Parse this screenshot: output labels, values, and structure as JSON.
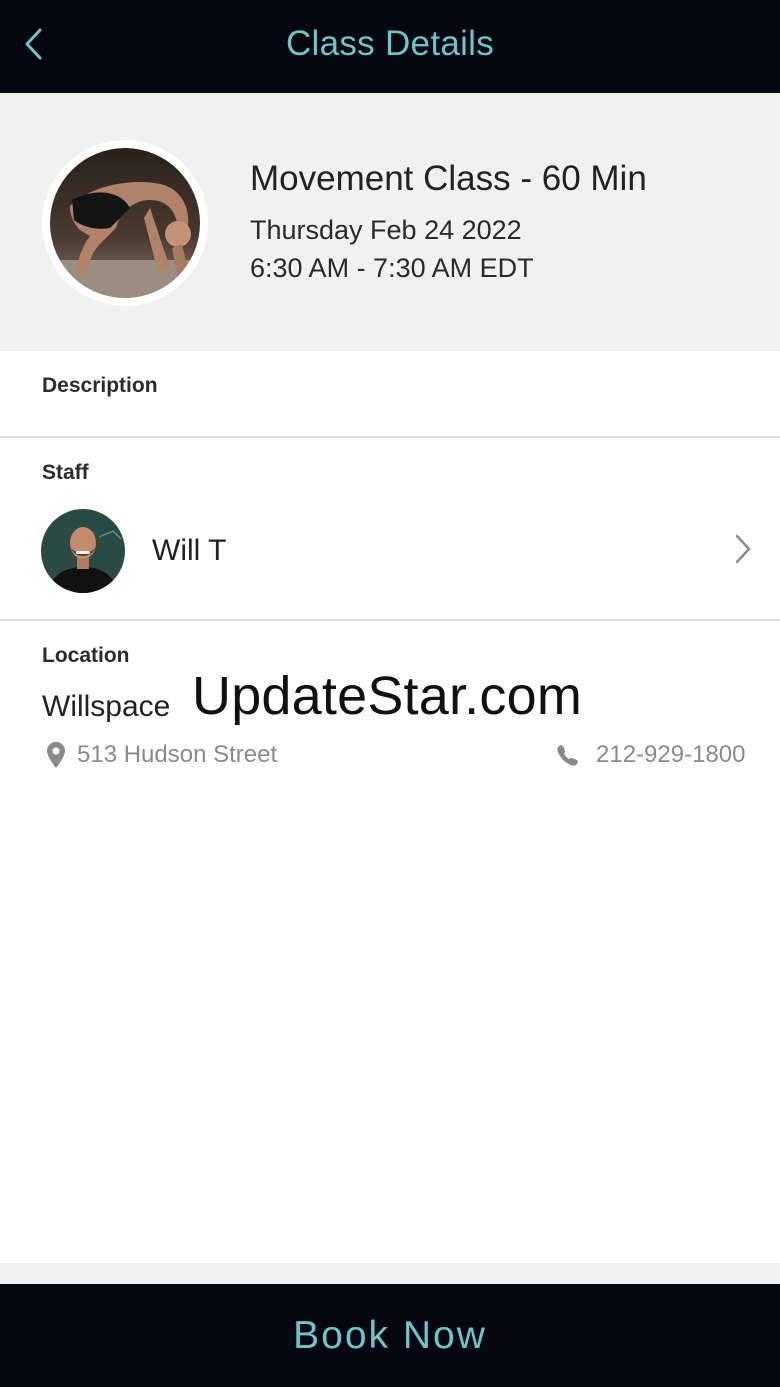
{
  "header": {
    "title": "Class Details",
    "back_icon": "chevron-left-icon"
  },
  "class": {
    "name": "Movement Class - 60 Min",
    "date": "Thursday Feb 24 2022",
    "time": "6:30 AM - 7:30 AM EDT"
  },
  "description": {
    "label": "Description"
  },
  "staff": {
    "label": "Staff",
    "name": "Will T"
  },
  "location": {
    "label": "Location",
    "name": "Willspace",
    "address": "513 Hudson Street",
    "phone": "212-929-1800"
  },
  "watermark": "UpdateStar.com",
  "footer": {
    "book_label": "Book Now"
  },
  "colors": {
    "bar_bg": "#05060f",
    "accent": "#6dc4c9",
    "hero_bg": "#f1f1f1",
    "muted_text": "#8a8a8a"
  }
}
